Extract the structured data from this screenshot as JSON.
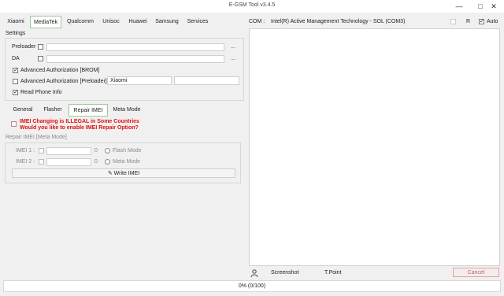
{
  "window": {
    "title": "E-GSM Tool v3.4.5",
    "minimize": "—",
    "maximize": "□",
    "close": "✕"
  },
  "top_tabs": [
    "Xiaomi",
    "MediaTek",
    "Qualcomm",
    "Unisoc",
    "Huawei",
    "Samsung",
    "Services"
  ],
  "active_top_tab": "MediaTek",
  "settings": {
    "label": "Settings",
    "preloader_label": "Preloader",
    "preloader_value": "",
    "da_label": "DA",
    "da_value": "",
    "browse": "...",
    "adv_auth_brom": "Advanced Authorization [BROM]",
    "adv_auth_brom_checked": true,
    "adv_auth_preloader": "Advanced Authorization [Preloader]",
    "adv_auth_preloader_checked": false,
    "brand_value": "Xiaomi",
    "extra_value": "",
    "read_phone_info": "Read Phone Info",
    "read_phone_info_checked": true
  },
  "sub_tabs": [
    "General",
    "Flasher",
    "Repair IMEI",
    "Meta Mode"
  ],
  "active_sub_tab": "Repair IMEI",
  "repair": {
    "warning_line1": "IMEI Changing is ILLEGAL in Some Countries",
    "warning_line2": "Would you like to enable IMEI Repair Option?",
    "group_label": "Repair IMEI [Meta Mode]",
    "imei1_label": "IMEI 1 :",
    "imei1_value": "",
    "imei1_count": "0",
    "imei2_label": "IMEI 2 :",
    "imei2_value": "",
    "imei2_count": "0",
    "flash_mode": "Flash Mode",
    "meta_mode": "Meta Mode",
    "write_imei": "Write IMEI"
  },
  "com": {
    "label": "COM :",
    "value": "Intel(R) Active Management Technology - SOL (COM3)",
    "r_label": "R",
    "auto_label": "Auto",
    "auto_checked": true
  },
  "bottom": {
    "screenshot": "Screenshot",
    "tpoint": "T.Point",
    "cancel": "Cancel"
  },
  "progress": {
    "text": "0%  (0/100)",
    "fraction": 0
  }
}
